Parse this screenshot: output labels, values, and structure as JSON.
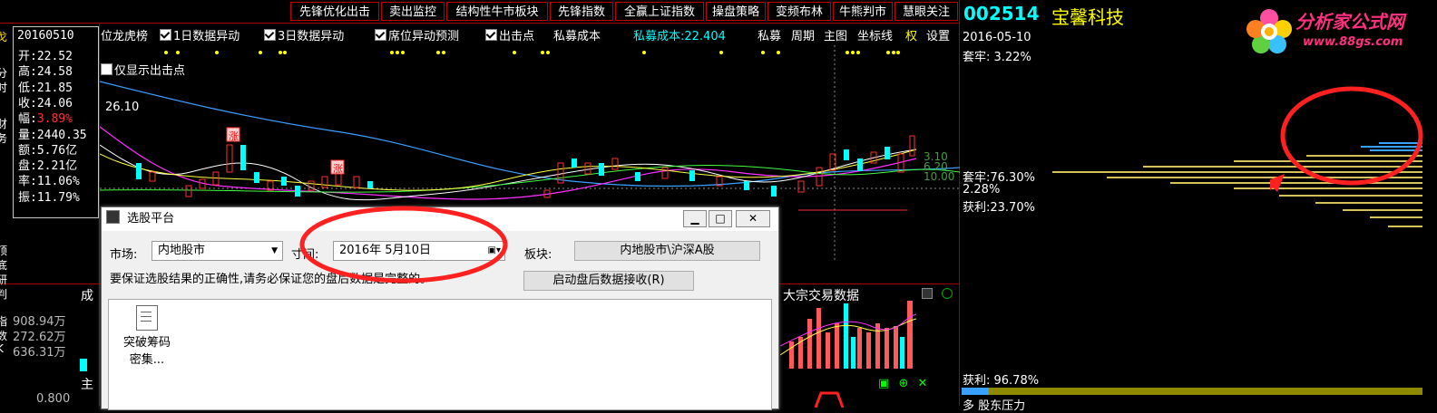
{
  "menu": {
    "items": [
      "先锋优化出击",
      "卖出监控",
      "结构性牛市板块",
      "先锋指数",
      "全赢上证指数",
      "操盘策略",
      "变频布林",
      "牛熊判市",
      "慧眼关注"
    ]
  },
  "stock": {
    "code": "002514",
    "name": "宝馨科技"
  },
  "watermark": {
    "brand": "分析家公式网",
    "url": "www.88gs.com"
  },
  "left_edge": {
    "chars": [
      "戈",
      "分",
      "时",
      "财",
      "务",
      "顶",
      "底",
      "研",
      "判",
      "指",
      "数",
      "K"
    ]
  },
  "info": {
    "date": "20160510",
    "rows": [
      {
        "label": "开:",
        "value": "22.52",
        "color": "#ffffff"
      },
      {
        "label": "高:",
        "value": "24.58",
        "color": "#ffffff"
      },
      {
        "label": "低:",
        "value": "21.85",
        "color": "#ffffff"
      },
      {
        "label": "收:",
        "value": "24.06",
        "color": "#ffffff"
      },
      {
        "label": "幅:",
        "value": "3.89%",
        "color": "#ff3030"
      },
      {
        "label": "量:",
        "value": "2440.35",
        "color": "#ffffff"
      },
      {
        "label": "额:",
        "value": "5.76亿",
        "color": "#ffffff"
      },
      {
        "label": "盘:",
        "value": "2.21亿",
        "color": "#ffffff"
      },
      {
        "label": "率:",
        "value": "11.06%",
        "color": "#ffffff"
      },
      {
        "label": "振:",
        "value": "11.79%",
        "color": "#ffffff"
      }
    ]
  },
  "toolbar": {
    "prefix": "位龙虎榜",
    "items": [
      {
        "label": "1日数据异动",
        "checked": true
      },
      {
        "label": "3日数据异动",
        "checked": true
      },
      {
        "label": "席位异动预测",
        "checked": true
      },
      {
        "label": "出击点",
        "checked": true
      }
    ],
    "private_cost": "私募成本",
    "private_cost_value": "私募成本:22.404",
    "private_short": "私募",
    "period": "周期",
    "main_chart": "主图",
    "coord_line": "坐标线",
    "right": "权",
    "settings": "设置",
    "only_show": "仅显示出击点",
    "price_high": "26.10"
  },
  "chart_labels": {
    "zhang": "涨",
    "ma_vals": [
      "3.10",
      "6.20",
      "10.00"
    ]
  },
  "left_volume": {
    "label_top": "成",
    "values": [
      "908.94万",
      "272.62万",
      "636.31万"
    ],
    "main": "主",
    "bottom": "0.800"
  },
  "block_panel": {
    "title": "大宗交易数据"
  },
  "right_panel": {
    "date": "2016-05-10",
    "trapped_top": "套牢: 3.22%",
    "trapped_mid": "套牢:76.30%",
    "pct_mid": "2.28%",
    "profit_mid": "获利:23.70%",
    "profit_bottom": "获利: 96.78%",
    "footer": "多   股东压力"
  },
  "dialog": {
    "title": "选股平台",
    "market_label": "市场:",
    "market_value": "内地股市",
    "time_label": "寸间:",
    "time_value": "2016年  5月10日",
    "sector_label": "板块:",
    "sector_value": "内地股市\\沪深A股",
    "notice": "要保证选股结果的正确性,请务必保证您的盘后数据是完整的。",
    "receive_button": "启动盘后数据接收(R)",
    "item_label_1": "突破筹码",
    "item_label_2": "密集..."
  },
  "colors": {
    "accent_red": "#ff0000",
    "cyan": "#00ffff",
    "yellow": "#ffff00",
    "border": "#a00000"
  }
}
